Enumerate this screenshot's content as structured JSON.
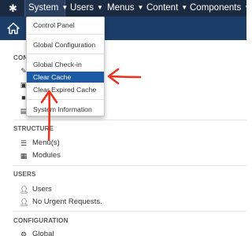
{
  "topbar": {
    "logo_icon": "joomla-icon",
    "menus": [
      {
        "label": "System"
      },
      {
        "label": "Users"
      },
      {
        "label": "Menus"
      },
      {
        "label": "Content"
      },
      {
        "label": "Components"
      }
    ]
  },
  "dropdown": {
    "items": [
      {
        "label": "Control Panel"
      },
      {
        "label": "Global Configuration"
      },
      {
        "label": "Global Check-in"
      },
      {
        "label": "Clear Cache"
      },
      {
        "label": "Clear Expired Cache"
      },
      {
        "label": "System Information"
      }
    ],
    "active_index": 3
  },
  "sidebar": {
    "content_title_fragment": "CONT",
    "structure": {
      "title": "STRUCTURE",
      "items": [
        {
          "label": "Menu(s)"
        },
        {
          "label": "Modules"
        }
      ]
    },
    "users": {
      "title": "USERS",
      "items": [
        {
          "label": "Users"
        },
        {
          "label": "No Urgent Requests."
        }
      ]
    },
    "configuration": {
      "title": "CONFIGURATION",
      "items": [
        {
          "label": "Global"
        }
      ]
    }
  },
  "colors": {
    "topbar": "#1b2a40",
    "header": "#1a3e67",
    "active_item": "#1c5aa6",
    "annotation_arrow": "#e8341f"
  }
}
